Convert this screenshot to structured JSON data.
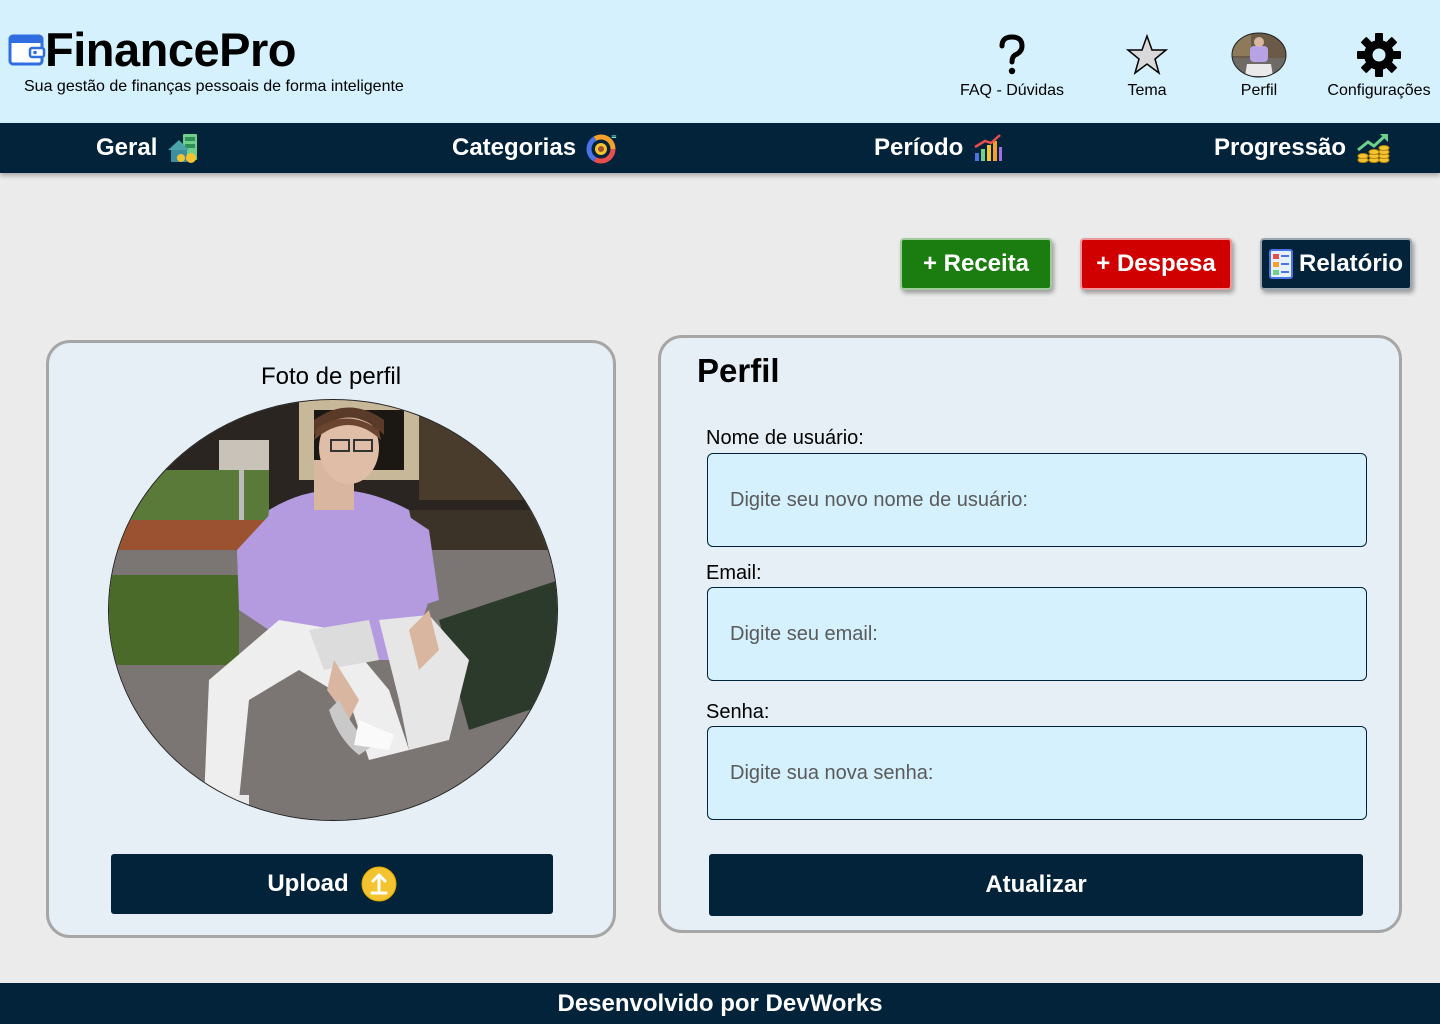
{
  "header": {
    "title": "FinancePro",
    "subtitle": "Sua gestão de finanças pessoais de forma inteligente",
    "items": [
      {
        "label": "FAQ - Dúvidas",
        "icon": "question-icon"
      },
      {
        "label": "Tema",
        "icon": "star-icon"
      },
      {
        "label": "Perfil",
        "icon": "avatar"
      },
      {
        "label": "Configurações",
        "icon": "gear-icon"
      }
    ]
  },
  "nav": {
    "items": [
      {
        "label": "Geral",
        "icon": "money-house-icon"
      },
      {
        "label": "Categorias",
        "icon": "pie-chart-icon"
      },
      {
        "label": "Período",
        "icon": "bar-chart-icon"
      },
      {
        "label": "Progressão",
        "icon": "growth-coins-icon"
      }
    ]
  },
  "actions": {
    "receita": "+ Receita",
    "despesa": "+ Despesa",
    "relatorio": "Relatório"
  },
  "photo_card": {
    "title": "Foto de perfil",
    "upload": "Upload"
  },
  "profile_card": {
    "title": "Perfil",
    "username_label": "Nome de usuário:",
    "username_placeholder": "Digite seu novo nome de usuário:",
    "email_label": "Email:",
    "email_placeholder": "Digite seu email:",
    "password_label": "Senha:",
    "password_placeholder": "Digite sua nova senha:",
    "submit": "Atualizar"
  },
  "footer": {
    "text": "Desenvolvido por DevWorks"
  },
  "colors": {
    "header_bg": "#d4f1fd",
    "navy": "#03233a",
    "receita": "#1b7c10",
    "despesa": "#d10000",
    "page_bg": "#ebebeb",
    "card_bg": "#e6eff6"
  }
}
